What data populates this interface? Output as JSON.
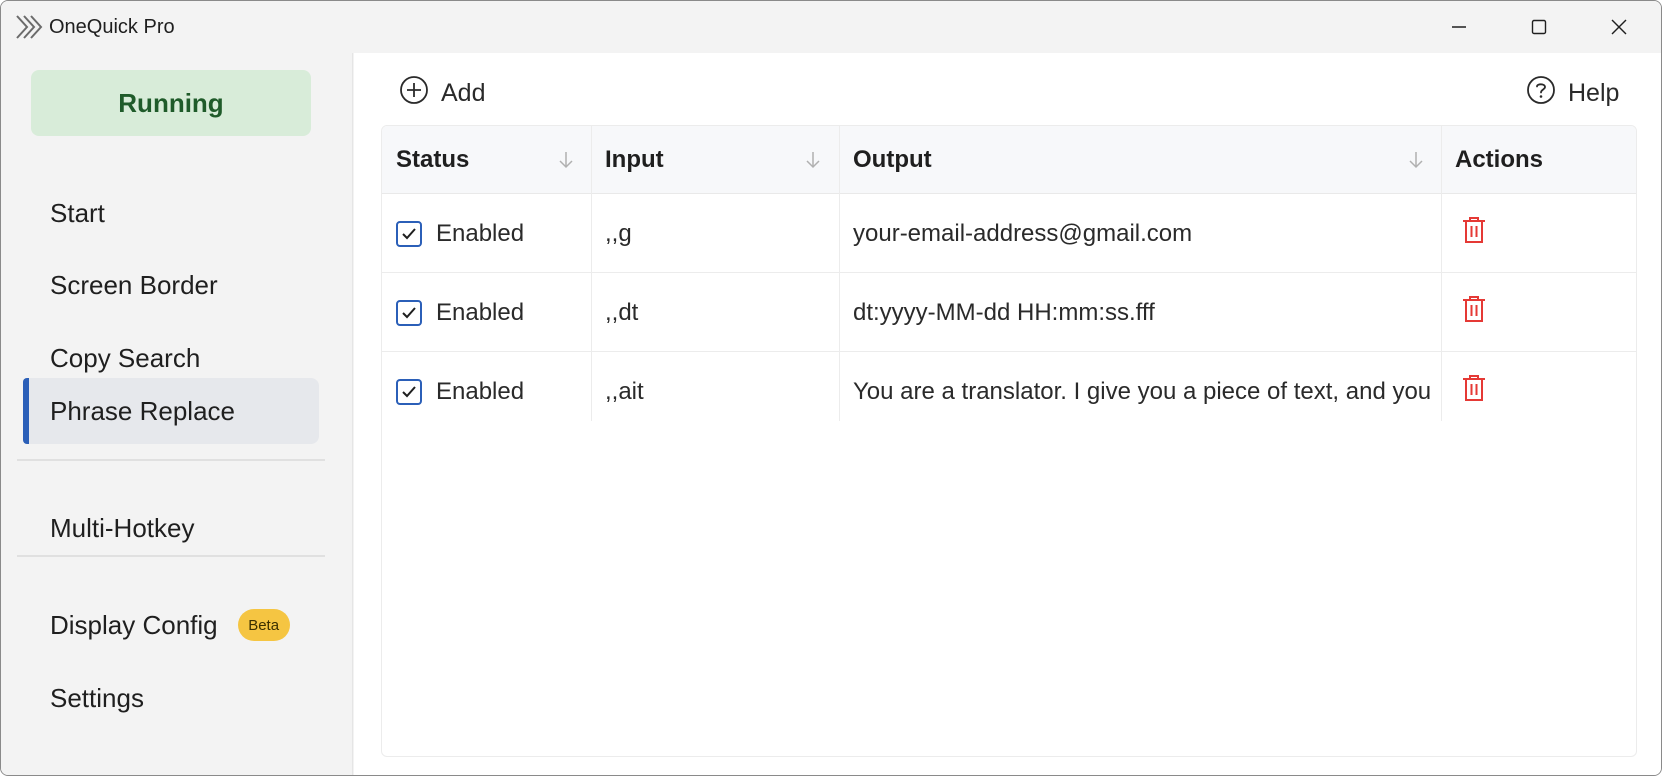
{
  "window": {
    "title": "OneQuick Pro",
    "controls": {
      "minimize": "minimize-icon",
      "maximize": "maximize-icon",
      "close": "close-icon"
    }
  },
  "sidebar": {
    "status": "Running",
    "items": [
      {
        "label": "Start",
        "active": false
      },
      {
        "label": "Screen Border",
        "active": false
      },
      {
        "label": "Copy Search",
        "active": false
      },
      {
        "label": "Phrase Replace",
        "active": true
      },
      {
        "label": "Multi-Hotkey",
        "active": false
      },
      {
        "label": "Display Config",
        "active": false,
        "badge": "Beta"
      },
      {
        "label": "Settings",
        "active": false
      }
    ]
  },
  "toolbar": {
    "add_label": "Add",
    "help_label": "Help"
  },
  "table": {
    "columns": [
      "Status",
      "Input",
      "Output",
      "Actions"
    ],
    "rows": [
      {
        "checked": true,
        "status": "Enabled",
        "input": ",,g",
        "output": "your-email-address@gmail.com"
      },
      {
        "checked": true,
        "status": "Enabled",
        "input": ",,dt",
        "output": "dt:yyyy-MM-dd HH:mm:ss.fff"
      },
      {
        "checked": true,
        "status": "Enabled",
        "input": ",,ait",
        "output": "You are a translator. I give you a piece of text, and you di"
      }
    ]
  },
  "colors": {
    "accent": "#2b5fb8",
    "running_bg": "#d8ecd9",
    "running_text": "#1f5b2a",
    "badge_bg": "#f5c542",
    "delete": "#e53935"
  }
}
